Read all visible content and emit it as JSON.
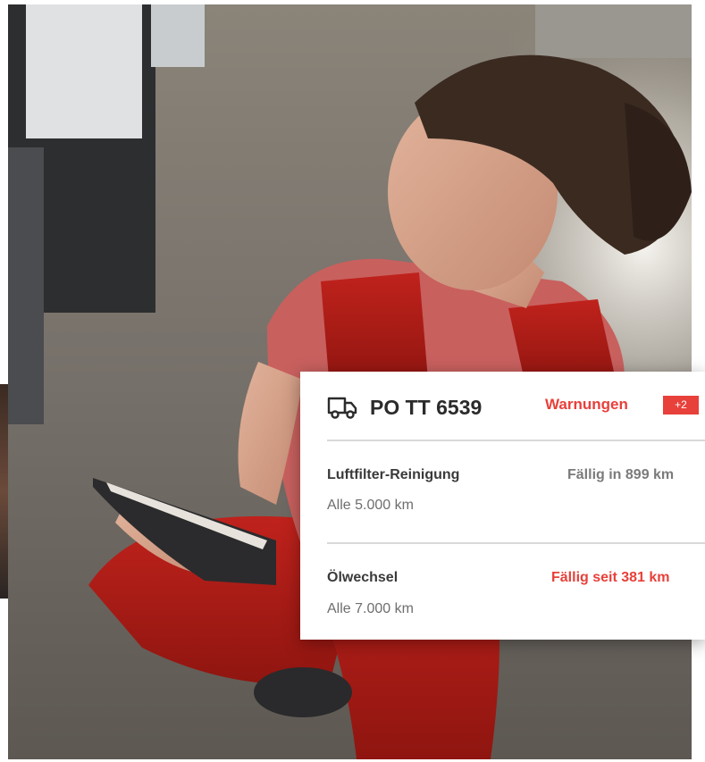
{
  "photo": {
    "description_icon": "mechanic-photo"
  },
  "vehicle": {
    "icon": "truck-icon",
    "plate": "PO TT 6539",
    "warnings_label": "Warnungen",
    "warnings_badge": "+2"
  },
  "maintenance": [
    {
      "title": "Luftfilter-Reinigung",
      "interval": "Alle 5.000 km",
      "status": "Fällig in 899 km",
      "status_level": "ok"
    },
    {
      "title": "Ölwechsel",
      "interval": "Alle 7.000 km",
      "status": "Fällig seit 381 km",
      "status_level": "overdue"
    }
  ],
  "colors": {
    "accent_red": "#e8403a",
    "text_dark": "#2b2b2b",
    "text_muted": "#6e6e6e",
    "divider": "#d9d9d9"
  }
}
